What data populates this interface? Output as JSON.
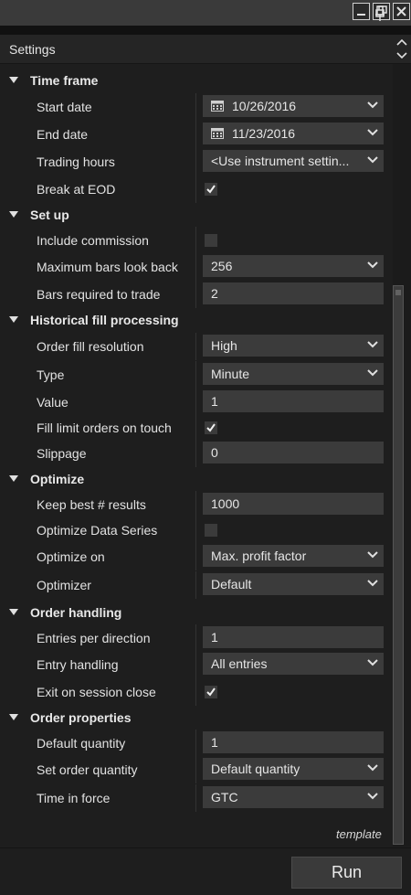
{
  "window": {
    "controls": [
      "minimize-icon",
      "restore-icon",
      "close-icon"
    ]
  },
  "header": {
    "title": "Settings"
  },
  "sections": {
    "time_frame": {
      "title": "Time frame",
      "start_date": {
        "label": "Start date",
        "value": "10/26/2016"
      },
      "end_date": {
        "label": "End date",
        "value": "11/23/2016"
      },
      "trading_hours": {
        "label": "Trading hours",
        "value": "<Use instrument settin..."
      },
      "break_at_eod": {
        "label": "Break at EOD",
        "checked": true
      }
    },
    "set_up": {
      "title": "Set up",
      "include_commission": {
        "label": "Include commission",
        "checked": false
      },
      "max_bars_look_back": {
        "label": "Maximum bars look back",
        "value": "256"
      },
      "bars_required": {
        "label": "Bars required to trade",
        "value": "2"
      }
    },
    "historical_fill": {
      "title": "Historical fill processing",
      "order_fill_resolution": {
        "label": "Order fill resolution",
        "value": "High"
      },
      "type": {
        "label": "Type",
        "value": "Minute"
      },
      "value": {
        "label": "Value",
        "value": "1"
      },
      "fill_limit_on_touch": {
        "label": "Fill limit orders on touch",
        "checked": true
      },
      "slippage": {
        "label": "Slippage",
        "value": "0"
      }
    },
    "optimize": {
      "title": "Optimize",
      "keep_best": {
        "label": "Keep best # results",
        "value": "1000"
      },
      "optimize_data_series": {
        "label": "Optimize Data Series",
        "checked": false
      },
      "optimize_on": {
        "label": "Optimize on",
        "value": "Max. profit factor"
      },
      "optimizer": {
        "label": "Optimizer",
        "value": "Default"
      }
    },
    "order_handling": {
      "title": "Order handling",
      "entries_per_direction": {
        "label": "Entries per direction",
        "value": "1"
      },
      "entry_handling": {
        "label": "Entry handling",
        "value": "All entries"
      },
      "exit_on_session_close": {
        "label": "Exit on session close",
        "checked": true
      }
    },
    "order_properties": {
      "title": "Order properties",
      "default_quantity": {
        "label": "Default quantity",
        "value": "1"
      },
      "set_order_quantity": {
        "label": "Set order quantity",
        "value": "Default quantity"
      },
      "time_in_force": {
        "label": "Time in force",
        "value": "GTC"
      }
    }
  },
  "footer": {
    "template_label": "template",
    "run_label": "Run"
  },
  "colors": {
    "background": "#1e1e1e",
    "field": "#3b3b3b",
    "text": "#e6e6e6"
  }
}
